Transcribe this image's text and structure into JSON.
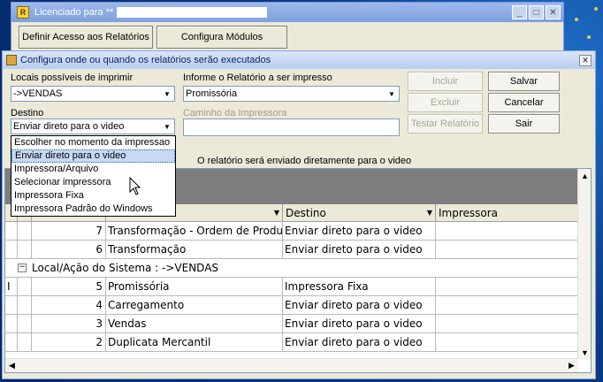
{
  "back_window": {
    "title": "Licenciado para **",
    "button_define": "Definir Acesso aos Relatórios",
    "button_configure": "Configura Módulos"
  },
  "dialog": {
    "title": "Configura onde ou quando os relatórios serão executados",
    "locais_label": "Locais possíveis de imprimir",
    "locais_value": "->VENDAS",
    "relatorio_label": "Informe o Relatório a ser impresso",
    "relatorio_value": "Promissória",
    "destino_label": "Destino",
    "destino_value": "Enviar direto para o video",
    "caminho_label": "Caminho da Impressora",
    "info_text": "O relatório será enviado diretamente para o video",
    "buttons": {
      "incluir": "Incluir",
      "excluir": "Excluir",
      "testar": "Testar Relatório",
      "salvar": "Salvar",
      "cancelar": "Cancelar",
      "sair": "Sair"
    },
    "destino_options": [
      "Escolher no momento da impressao",
      "Enviar direto para o video",
      "Impressora/Arquivo",
      "Selecionar impressora",
      "Impressora Fixa",
      "Impressora Padrão do Windows"
    ],
    "destino_selected_index": 1
  },
  "grid": {
    "columns": {
      "destino": "Destino",
      "impressora": "Impressora"
    },
    "rows_top": [
      {
        "num": "7",
        "relatorio": "Transformação - Ordem de Produção",
        "destino": "Enviar direto para o video"
      },
      {
        "num": "6",
        "relatorio": "Transformação",
        "destino": "Enviar direto para o video"
      }
    ],
    "group_label": "Local/Ação do Sistema : ->VENDAS",
    "expander": "−",
    "rows_group": [
      {
        "marker": "I",
        "num": "5",
        "relatorio": "Promissória",
        "destino": "Impressora Fixa"
      },
      {
        "marker": "",
        "num": "4",
        "relatorio": "Carregamento",
        "destino": "Enviar direto para o video"
      },
      {
        "marker": "",
        "num": "3",
        "relatorio": "Vendas",
        "destino": "Enviar direto para o video"
      },
      {
        "marker": "",
        "num": "2",
        "relatorio": "Duplicata Mercantil",
        "destino": "Enviar direto para o video"
      }
    ]
  }
}
